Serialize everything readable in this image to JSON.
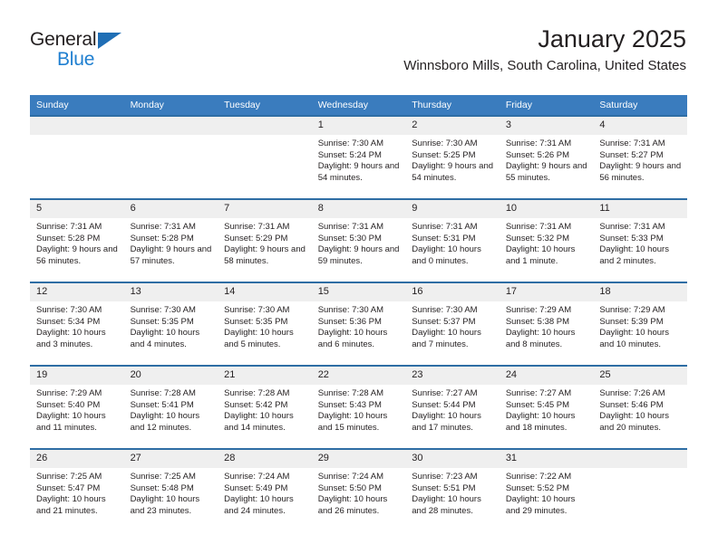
{
  "brand": {
    "name_top": "General",
    "name_bottom": "Blue",
    "triangle_color": "#1f6eb5",
    "blue_text_color": "#1f7fd0"
  },
  "header": {
    "title": "January 2025",
    "subtitle": "Winnsboro Mills, South Carolina, United States"
  },
  "colors": {
    "header_bar": "#3a7cbe",
    "row_rule": "#2e6da4",
    "daynum_strip": "#efefef",
    "text": "#231f20"
  },
  "labels": {
    "sunrise_prefix": "Sunrise: ",
    "sunset_prefix": "Sunset: ",
    "daylight_prefix": "Daylight: "
  },
  "weekdays": [
    "Sunday",
    "Monday",
    "Tuesday",
    "Wednesday",
    "Thursday",
    "Friday",
    "Saturday"
  ],
  "weeks": [
    [
      {
        "day": "",
        "empty": true
      },
      {
        "day": "",
        "empty": true
      },
      {
        "day": "",
        "empty": true
      },
      {
        "day": "1",
        "sunrise": "Sunrise: 7:30 AM",
        "sunset": "Sunset: 5:24 PM",
        "daylight": "Daylight: 9 hours and 54 minutes."
      },
      {
        "day": "2",
        "sunrise": "Sunrise: 7:30 AM",
        "sunset": "Sunset: 5:25 PM",
        "daylight": "Daylight: 9 hours and 54 minutes."
      },
      {
        "day": "3",
        "sunrise": "Sunrise: 7:31 AM",
        "sunset": "Sunset: 5:26 PM",
        "daylight": "Daylight: 9 hours and 55 minutes."
      },
      {
        "day": "4",
        "sunrise": "Sunrise: 7:31 AM",
        "sunset": "Sunset: 5:27 PM",
        "daylight": "Daylight: 9 hours and 56 minutes."
      }
    ],
    [
      {
        "day": "5",
        "sunrise": "Sunrise: 7:31 AM",
        "sunset": "Sunset: 5:28 PM",
        "daylight": "Daylight: 9 hours and 56 minutes."
      },
      {
        "day": "6",
        "sunrise": "Sunrise: 7:31 AM",
        "sunset": "Sunset: 5:28 PM",
        "daylight": "Daylight: 9 hours and 57 minutes."
      },
      {
        "day": "7",
        "sunrise": "Sunrise: 7:31 AM",
        "sunset": "Sunset: 5:29 PM",
        "daylight": "Daylight: 9 hours and 58 minutes."
      },
      {
        "day": "8",
        "sunrise": "Sunrise: 7:31 AM",
        "sunset": "Sunset: 5:30 PM",
        "daylight": "Daylight: 9 hours and 59 minutes."
      },
      {
        "day": "9",
        "sunrise": "Sunrise: 7:31 AM",
        "sunset": "Sunset: 5:31 PM",
        "daylight": "Daylight: 10 hours and 0 minutes."
      },
      {
        "day": "10",
        "sunrise": "Sunrise: 7:31 AM",
        "sunset": "Sunset: 5:32 PM",
        "daylight": "Daylight: 10 hours and 1 minute."
      },
      {
        "day": "11",
        "sunrise": "Sunrise: 7:31 AM",
        "sunset": "Sunset: 5:33 PM",
        "daylight": "Daylight: 10 hours and 2 minutes."
      }
    ],
    [
      {
        "day": "12",
        "sunrise": "Sunrise: 7:30 AM",
        "sunset": "Sunset: 5:34 PM",
        "daylight": "Daylight: 10 hours and 3 minutes."
      },
      {
        "day": "13",
        "sunrise": "Sunrise: 7:30 AM",
        "sunset": "Sunset: 5:35 PM",
        "daylight": "Daylight: 10 hours and 4 minutes."
      },
      {
        "day": "14",
        "sunrise": "Sunrise: 7:30 AM",
        "sunset": "Sunset: 5:35 PM",
        "daylight": "Daylight: 10 hours and 5 minutes."
      },
      {
        "day": "15",
        "sunrise": "Sunrise: 7:30 AM",
        "sunset": "Sunset: 5:36 PM",
        "daylight": "Daylight: 10 hours and 6 minutes."
      },
      {
        "day": "16",
        "sunrise": "Sunrise: 7:30 AM",
        "sunset": "Sunset: 5:37 PM",
        "daylight": "Daylight: 10 hours and 7 minutes."
      },
      {
        "day": "17",
        "sunrise": "Sunrise: 7:29 AM",
        "sunset": "Sunset: 5:38 PM",
        "daylight": "Daylight: 10 hours and 8 minutes."
      },
      {
        "day": "18",
        "sunrise": "Sunrise: 7:29 AM",
        "sunset": "Sunset: 5:39 PM",
        "daylight": "Daylight: 10 hours and 10 minutes."
      }
    ],
    [
      {
        "day": "19",
        "sunrise": "Sunrise: 7:29 AM",
        "sunset": "Sunset: 5:40 PM",
        "daylight": "Daylight: 10 hours and 11 minutes."
      },
      {
        "day": "20",
        "sunrise": "Sunrise: 7:28 AM",
        "sunset": "Sunset: 5:41 PM",
        "daylight": "Daylight: 10 hours and 12 minutes."
      },
      {
        "day": "21",
        "sunrise": "Sunrise: 7:28 AM",
        "sunset": "Sunset: 5:42 PM",
        "daylight": "Daylight: 10 hours and 14 minutes."
      },
      {
        "day": "22",
        "sunrise": "Sunrise: 7:28 AM",
        "sunset": "Sunset: 5:43 PM",
        "daylight": "Daylight: 10 hours and 15 minutes."
      },
      {
        "day": "23",
        "sunrise": "Sunrise: 7:27 AM",
        "sunset": "Sunset: 5:44 PM",
        "daylight": "Daylight: 10 hours and 17 minutes."
      },
      {
        "day": "24",
        "sunrise": "Sunrise: 7:27 AM",
        "sunset": "Sunset: 5:45 PM",
        "daylight": "Daylight: 10 hours and 18 minutes."
      },
      {
        "day": "25",
        "sunrise": "Sunrise: 7:26 AM",
        "sunset": "Sunset: 5:46 PM",
        "daylight": "Daylight: 10 hours and 20 minutes."
      }
    ],
    [
      {
        "day": "26",
        "sunrise": "Sunrise: 7:25 AM",
        "sunset": "Sunset: 5:47 PM",
        "daylight": "Daylight: 10 hours and 21 minutes."
      },
      {
        "day": "27",
        "sunrise": "Sunrise: 7:25 AM",
        "sunset": "Sunset: 5:48 PM",
        "daylight": "Daylight: 10 hours and 23 minutes."
      },
      {
        "day": "28",
        "sunrise": "Sunrise: 7:24 AM",
        "sunset": "Sunset: 5:49 PM",
        "daylight": "Daylight: 10 hours and 24 minutes."
      },
      {
        "day": "29",
        "sunrise": "Sunrise: 7:24 AM",
        "sunset": "Sunset: 5:50 PM",
        "daylight": "Daylight: 10 hours and 26 minutes."
      },
      {
        "day": "30",
        "sunrise": "Sunrise: 7:23 AM",
        "sunset": "Sunset: 5:51 PM",
        "daylight": "Daylight: 10 hours and 28 minutes."
      },
      {
        "day": "31",
        "sunrise": "Sunrise: 7:22 AM",
        "sunset": "Sunset: 5:52 PM",
        "daylight": "Daylight: 10 hours and 29 minutes."
      },
      {
        "day": "",
        "empty": true
      }
    ]
  ]
}
